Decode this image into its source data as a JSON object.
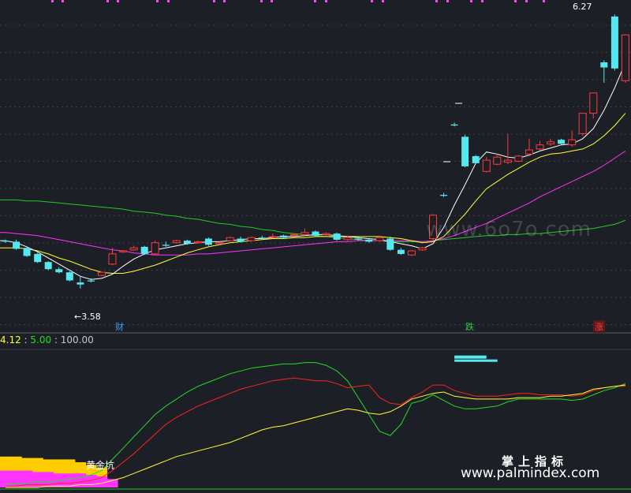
{
  "chart_data": [
    {
      "type": "candlestick",
      "price_labels": {
        "high": "6.27",
        "low": "3.58"
      },
      "event_marks": [
        {
          "text": "财",
          "color": "#3da0ff"
        },
        {
          "text": "跌",
          "color": "#2ecc40"
        },
        {
          "text": "涨",
          "color": "#ff3b3b"
        }
      ],
      "ylim": [
        3.3,
        6.35
      ],
      "colors": {
        "up": "#ff3b3b",
        "down": "#56e8f0",
        "ma5": "#ffffff",
        "ma10": "#ffff33",
        "ma20": "#ff33ff",
        "ma60": "#22cc22"
      },
      "candles": [
        [
          4.05,
          4.06,
          4.04,
          4.03
        ],
        [
          4.04,
          4.06,
          3.97,
          3.96
        ],
        [
          3.98,
          3.99,
          3.9,
          3.89
        ],
        [
          3.92,
          3.93,
          3.84,
          3.83
        ],
        [
          3.84,
          3.85,
          3.77,
          3.76
        ],
        [
          3.77,
          3.79,
          3.74,
          3.73
        ],
        [
          3.74,
          3.75,
          3.66,
          3.65
        ],
        [
          3.64,
          3.7,
          3.62,
          3.58
        ],
        [
          3.66,
          3.68,
          3.65,
          3.64
        ],
        [
          3.71,
          3.72,
          3.74,
          3.7
        ],
        [
          3.82,
          3.98,
          3.92,
          3.81
        ],
        [
          3.94,
          3.96,
          3.95,
          3.93
        ],
        [
          3.96,
          4.0,
          3.98,
          3.95
        ],
        [
          3.99,
          4.0,
          3.92,
          3.91
        ],
        [
          3.92,
          4.05,
          4.03,
          3.91
        ],
        [
          4.01,
          4.04,
          4.0,
          3.99
        ],
        [
          4.03,
          4.06,
          4.05,
          4.02
        ],
        [
          4.05,
          4.06,
          4.02,
          4.01
        ],
        [
          4.03,
          4.05,
          4.04,
          4.02
        ],
        [
          4.07,
          4.08,
          4.01,
          4.0
        ],
        [
          4.02,
          4.04,
          4.03,
          4.01
        ],
        [
          4.05,
          4.09,
          4.08,
          4.04
        ],
        [
          4.07,
          4.09,
          4.04,
          4.03
        ],
        [
          4.05,
          4.09,
          4.08,
          4.04
        ],
        [
          4.08,
          4.1,
          4.07,
          4.06
        ],
        [
          4.09,
          4.12,
          4.09,
          4.08
        ],
        [
          4.1,
          4.11,
          4.08,
          4.07
        ],
        [
          4.1,
          4.12,
          4.11,
          4.09
        ],
        [
          4.11,
          4.17,
          4.13,
          4.1
        ],
        [
          4.14,
          4.15,
          4.1,
          4.09
        ],
        [
          4.11,
          4.13,
          4.12,
          4.1
        ],
        [
          4.12,
          4.13,
          4.06,
          4.05
        ],
        [
          4.06,
          4.1,
          4.08,
          4.05
        ],
        [
          4.07,
          4.08,
          4.06,
          4.05
        ],
        [
          4.06,
          4.07,
          4.04,
          4.03
        ],
        [
          4.05,
          4.1,
          4.08,
          4.04
        ],
        [
          4.07,
          4.09,
          3.96,
          3.95
        ],
        [
          3.96,
          3.98,
          3.92,
          3.91
        ],
        [
          3.91,
          3.96,
          3.95,
          3.9
        ],
        [
          3.96,
          3.99,
          3.98,
          3.95
        ],
        [
          4.07,
          4.31,
          4.3,
          4.05
        ],
        [
          4.5,
          4.52,
          4.49,
          4.48
        ],
        [
          5.19,
          5.21,
          5.18,
          5.17
        ],
        [
          5.07,
          5.09,
          4.78,
          4.77
        ],
        [
          4.88,
          4.89,
          4.81,
          4.8
        ],
        [
          4.73,
          4.87,
          4.84,
          4.72
        ],
        [
          4.8,
          4.9,
          4.87,
          4.79
        ],
        [
          4.82,
          5.1,
          4.84,
          4.8
        ],
        [
          4.83,
          4.89,
          4.88,
          4.82
        ],
        [
          4.9,
          5.05,
          4.94,
          4.88
        ],
        [
          4.95,
          5.03,
          4.99,
          4.94
        ],
        [
          5.0,
          5.05,
          5.02,
          4.98
        ],
        [
          5.04,
          5.05,
          5.0,
          4.99
        ],
        [
          4.99,
          5.13,
          5.04,
          4.97
        ],
        [
          5.1,
          5.3,
          5.3,
          5.08
        ],
        [
          5.3,
          5.5,
          5.5,
          5.25
        ],
        [
          5.8,
          5.82,
          5.75,
          5.6
        ],
        [
          6.25,
          6.27,
          5.74,
          5.72
        ],
        [
          5.62,
          6.07,
          6.07,
          5.6
        ]
      ],
      "ma5": [
        4.05,
        4.03,
        3.99,
        3.94,
        3.88,
        3.82,
        3.76,
        3.7,
        3.67,
        3.68,
        3.72,
        3.8,
        3.87,
        3.92,
        3.96,
        3.98,
        4.0,
        4.02,
        4.03,
        4.04,
        4.04,
        4.05,
        4.06,
        4.07,
        4.07,
        4.08,
        4.09,
        4.09,
        4.1,
        4.11,
        4.11,
        4.1,
        4.09,
        4.08,
        4.07,
        4.06,
        4.04,
        4.02,
        4.0,
        3.97,
        4.02,
        4.18,
        4.4,
        4.6,
        4.81,
        4.92,
        4.9,
        4.87,
        4.86,
        4.89,
        4.93,
        4.96,
        4.99,
        5.0,
        5.05,
        5.15,
        5.33,
        5.55,
        5.8
      ],
      "ma10": [
        3.98,
        3.98,
        3.97,
        3.95,
        3.92,
        3.88,
        3.85,
        3.81,
        3.77,
        3.74,
        3.73,
        3.73,
        3.75,
        3.78,
        3.81,
        3.85,
        3.89,
        3.93,
        3.96,
        3.99,
        4.01,
        4.03,
        4.04,
        4.05,
        4.06,
        4.07,
        4.07,
        4.08,
        4.08,
        4.09,
        4.09,
        4.09,
        4.09,
        4.09,
        4.09,
        4.09,
        4.08,
        4.07,
        4.05,
        4.03,
        4.04,
        4.09,
        4.2,
        4.31,
        4.44,
        4.56,
        4.63,
        4.7,
        4.76,
        4.82,
        4.87,
        4.9,
        4.91,
        4.93,
        4.95,
        5.0,
        5.08,
        5.18,
        5.3
      ],
      "ma20": [
        4.13,
        4.12,
        4.11,
        4.1,
        4.08,
        4.06,
        4.04,
        4.02,
        4.0,
        3.98,
        3.96,
        3.95,
        3.93,
        3.92,
        3.91,
        3.91,
        3.91,
        3.91,
        3.92,
        3.92,
        3.93,
        3.94,
        3.95,
        3.96,
        3.97,
        3.98,
        3.99,
        4.0,
        4.01,
        4.02,
        4.03,
        4.04,
        4.04,
        4.05,
        4.05,
        4.05,
        4.05,
        4.05,
        4.05,
        4.04,
        4.05,
        4.07,
        4.1,
        4.14,
        4.18,
        4.22,
        4.27,
        4.32,
        4.37,
        4.42,
        4.48,
        4.53,
        4.58,
        4.63,
        4.68,
        4.73,
        4.79,
        4.86,
        4.93
      ],
      "ma60": [
        4.45,
        4.45,
        4.44,
        4.44,
        4.43,
        4.42,
        4.41,
        4.4,
        4.39,
        4.38,
        4.37,
        4.36,
        4.34,
        4.33,
        4.32,
        4.3,
        4.29,
        4.27,
        4.26,
        4.24,
        4.22,
        4.21,
        4.19,
        4.18,
        4.16,
        4.15,
        4.13,
        4.12,
        4.11,
        4.1,
        4.09,
        4.08,
        4.07,
        4.06,
        4.05,
        4.05,
        4.04,
        4.04,
        4.04,
        4.04,
        4.05,
        4.06,
        4.07,
        4.08,
        4.09,
        4.1,
        4.1,
        4.11,
        4.11,
        4.12,
        4.12,
        4.13,
        4.14,
        4.15,
        4.16,
        4.17,
        4.19,
        4.21,
        4.25
      ]
    },
    {
      "type": "line",
      "header": [
        {
          "text": "4.12",
          "color": "#ffff33"
        },
        {
          "text": " : ",
          "color": "#c8c8c8"
        },
        {
          "text": "5.00",
          "color": "#22dd22"
        },
        {
          "text": " : ",
          "color": "#c8c8c8"
        },
        {
          "text": "100.00",
          "color": "#c8c8c8"
        }
      ],
      "ylim": [
        0,
        100
      ],
      "annotation": "黄金坑",
      "series": [
        {
          "color": "#22dd22",
          "values": [
            2,
            3,
            3,
            4,
            4,
            5,
            6,
            7,
            9,
            12,
            20,
            28,
            36,
            44,
            52,
            58,
            63,
            68,
            72,
            75,
            78,
            81,
            83,
            85,
            86,
            87,
            88,
            88,
            89,
            89,
            87,
            83,
            76,
            64,
            52,
            40,
            37,
            45,
            60,
            62,
            66,
            62,
            58,
            56,
            56,
            57,
            58,
            61,
            63,
            63,
            63,
            63,
            63,
            62,
            63,
            66,
            69,
            71,
            74
          ]
        },
        {
          "color": "#ff2222",
          "values": [
            1,
            1,
            2,
            2,
            2,
            3,
            3,
            4,
            5,
            7,
            12,
            18,
            24,
            31,
            38,
            45,
            50,
            54,
            58,
            61,
            64,
            67,
            70,
            72,
            74,
            76,
            77,
            78,
            77,
            76,
            76,
            74,
            71,
            72,
            73,
            64,
            60,
            59,
            64,
            68,
            73,
            73,
            69,
            67,
            65,
            65,
            65,
            66,
            67,
            67,
            66,
            66,
            66,
            65,
            66,
            69,
            71,
            72,
            72
          ]
        },
        {
          "color": "#ffff33",
          "values": [
            0,
            0,
            0,
            0,
            1,
            1,
            1,
            2,
            2,
            3,
            5,
            7,
            10,
            13,
            16,
            19,
            22,
            24,
            26,
            28,
            30,
            32,
            35,
            38,
            41,
            43,
            44,
            46,
            48,
            50,
            52,
            54,
            56,
            55,
            53,
            52,
            54,
            58,
            63,
            65,
            67,
            68,
            65,
            64,
            63,
            63,
            63,
            63,
            64,
            64,
            64,
            65,
            65,
            66,
            67,
            70,
            71,
            72,
            73
          ]
        }
      ],
      "bars": [
        {
          "color": "#ffcc00",
          "values": [
            22,
            22,
            21,
            21,
            20,
            20,
            20,
            18,
            16,
            14,
            0
          ]
        },
        {
          "color": "#ff33ff",
          "values": [
            12,
            12,
            12,
            11,
            11,
            10,
            10,
            10,
            9,
            8,
            6
          ]
        }
      ],
      "top_blocks": [
        {
          "from": 38,
          "to": 40,
          "level": 88,
          "color": "#56e8f0"
        }
      ]
    }
  ]
}
